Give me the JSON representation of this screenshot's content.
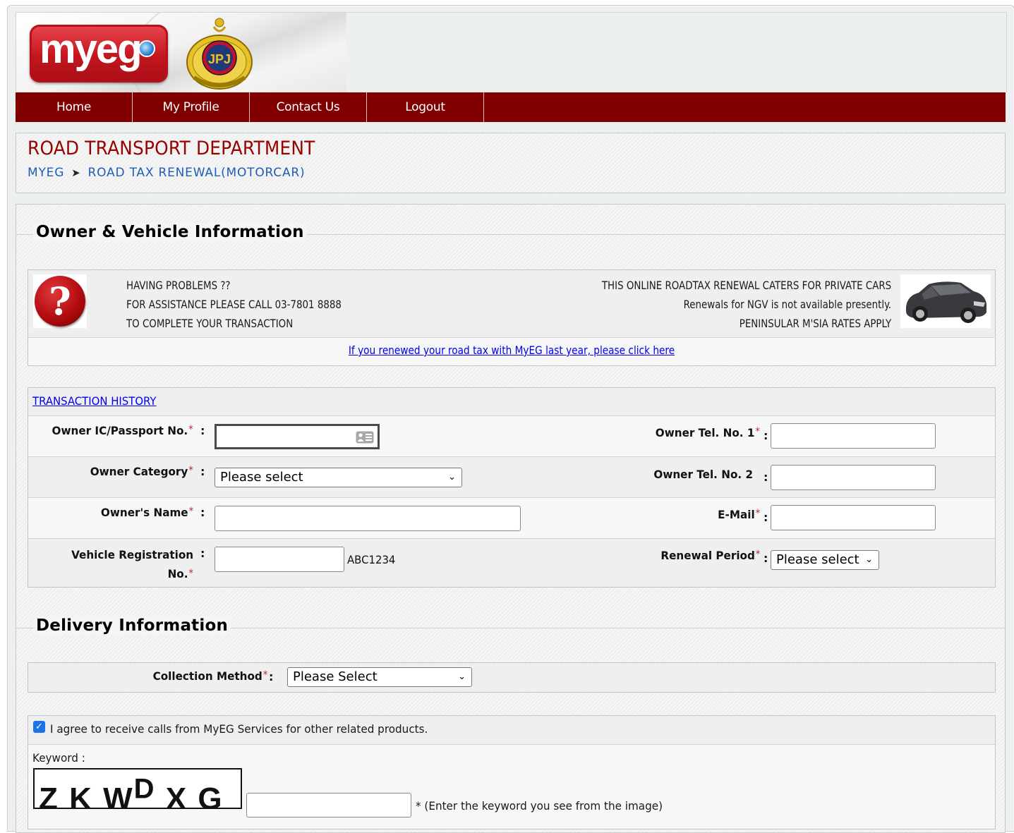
{
  "header": {
    "logo_text": "myeg",
    "emblem_text": "JPJ"
  },
  "nav": {
    "items": [
      {
        "label": "Home"
      },
      {
        "label": "My Profile"
      },
      {
        "label": "Contact Us"
      },
      {
        "label": "Logout"
      }
    ]
  },
  "page": {
    "title": "ROAD TRANSPORT DEPARTMENT",
    "breadcrumb": [
      "MYEG",
      "ROAD TAX RENEWAL(MOTORCAR)"
    ],
    "breadcrumb_separator": "➤"
  },
  "owner_section": {
    "legend": "Owner & Vehicle Information",
    "help": {
      "icon": "?",
      "lines": [
        "HAVING PROBLEMS ??",
        "FOR ASSISTANCE PLEASE CALL 03-7801 8888",
        "TO COMPLETE YOUR TRANSACTION"
      ]
    },
    "notice": {
      "lines": [
        "THIS ONLINE ROADTAX RENEWAL CATERS FOR PRIVATE CARS",
        "Renewals for NGV is not available presently.",
        "PENINSULAR M'SIA RATES APPLY"
      ]
    },
    "renew_link": "If you renewed your road tax with MyEG last year, please click here",
    "transaction_history_link": "TRANSACTION HISTORY",
    "fields": {
      "ic": {
        "label": "Owner IC/Passport No.",
        "required": "*",
        "value": ""
      },
      "category": {
        "label": "Owner Category",
        "required": "*",
        "selected": "Please select"
      },
      "name": {
        "label": "Owner's Name",
        "required": "*",
        "value": ""
      },
      "vehicle_reg": {
        "label_line1": "Vehicle Registration",
        "label_line2": "No.",
        "required": "*",
        "value": "",
        "example": "ABC1234"
      },
      "tel1": {
        "label": "Owner Tel. No. 1",
        "required": "*",
        "value": ""
      },
      "tel2": {
        "label": "Owner Tel. No. 2",
        "value": ""
      },
      "email": {
        "label": "E-Mail",
        "required": "*",
        "value": ""
      },
      "renewal_period": {
        "label": "Renewal Period",
        "required": "*",
        "selected": "Please select"
      }
    },
    "colon": ":"
  },
  "delivery_section": {
    "legend": "Delivery Information",
    "collection_method": {
      "label": "Collection Method",
      "required": "*",
      "selected": "Please Select"
    }
  },
  "consent": {
    "checked": true,
    "text": "I agree to receive calls from MyEG Services for other related products."
  },
  "captcha": {
    "label": "Keyword :",
    "image_text": "ZKWDXG",
    "value": "",
    "hint": "* (Enter the keyword you see from the image)"
  }
}
